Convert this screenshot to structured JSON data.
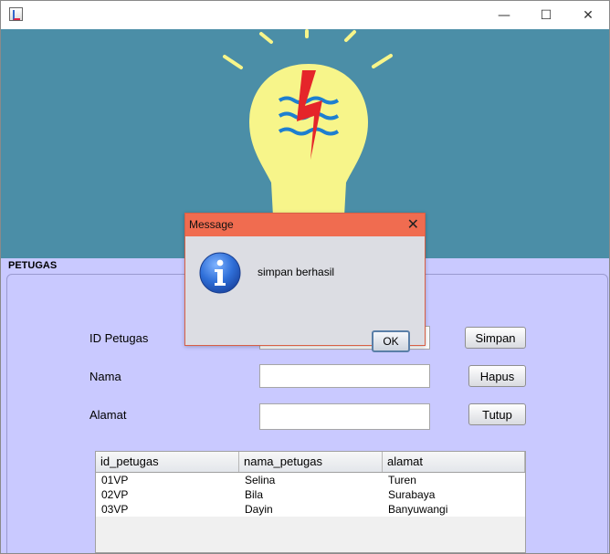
{
  "window": {
    "icon": "java-app-icon",
    "minimize": "—",
    "maximize": "☐",
    "close": "✕"
  },
  "banner": {
    "background": "#4b8ea7",
    "bulb_color": "#f7f58a",
    "logo": "lightning-waves-logo"
  },
  "section_title": "PETUGAS",
  "form": {
    "id_label": "ID Petugas",
    "nama_label": "Nama",
    "alamat_label": "Alamat",
    "id_value": "",
    "nama_value": "",
    "alamat_value": ""
  },
  "buttons": {
    "simpan": "Simpan",
    "hapus": "Hapus",
    "tutup": "Tutup"
  },
  "table": {
    "columns": [
      "id_petugas",
      "nama_petugas",
      "alamat"
    ],
    "rows": [
      [
        "01VP",
        "Selina",
        "Turen"
      ],
      [
        "02VP",
        "Bila",
        "Surabaya"
      ],
      [
        "03VP",
        "Dayin",
        "Banyuwangi"
      ]
    ]
  },
  "dialog": {
    "title": "Message",
    "close": "✕",
    "icon": "information-icon",
    "message": "simpan berhasil",
    "ok": "OK"
  }
}
